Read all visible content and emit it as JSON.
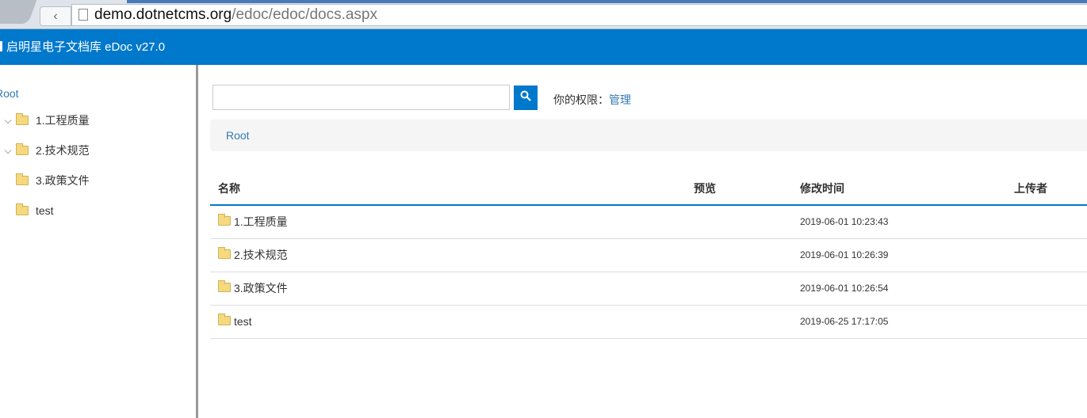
{
  "browser": {
    "url_host": "demo.dotnetcms.org",
    "url_path": "/edoc/edoc/docs.aspx"
  },
  "app": {
    "title": "启明星电子文档库 eDoc v27.0"
  },
  "sidebar": {
    "root": "Root",
    "items": [
      {
        "label": "1.工程质量",
        "expandable": true
      },
      {
        "label": "2.技术规范",
        "expandable": true
      },
      {
        "label": "3.政策文件",
        "expandable": false
      },
      {
        "label": "test",
        "expandable": false
      }
    ]
  },
  "search": {
    "value": "",
    "placeholder": ""
  },
  "permission": {
    "label": "你的权限：",
    "value": "管理"
  },
  "breadcrumb": {
    "root": "Root"
  },
  "table": {
    "headers": [
      "名称",
      "预览",
      "修改时间",
      "上传者"
    ],
    "rows": [
      {
        "name": "1.工程质量",
        "preview": "",
        "modified": "2019-06-01 10:23:43",
        "uploader": ""
      },
      {
        "name": "2.技术规范",
        "preview": "",
        "modified": "2019-06-01 10:26:39",
        "uploader": ""
      },
      {
        "name": "3.政策文件",
        "preview": "",
        "modified": "2019-06-01 10:26:54",
        "uploader": ""
      },
      {
        "name": "test",
        "preview": "",
        "modified": "2019-06-25 17:17:05",
        "uploader": ""
      }
    ]
  }
}
